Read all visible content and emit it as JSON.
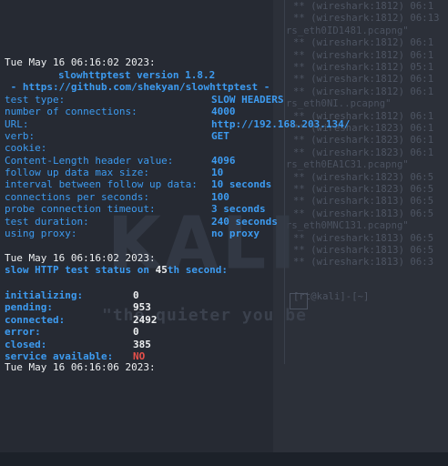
{
  "header": {
    "timestamp_1": "Tue May 16 06:16:02 2023:",
    "version": "slowhttptest version 1.8.2",
    "url_banner": " - https://github.com/shekyan/slowhttptest -"
  },
  "config": [
    {
      "label": "test type:",
      "value": "SLOW HEADERS"
    },
    {
      "label": "number of connections:",
      "value": "4000"
    },
    {
      "label": "URL:",
      "value": "http://192.168.203.134/"
    },
    {
      "label": "verb:",
      "value": "GET"
    },
    {
      "label": "cookie:",
      "value": ""
    },
    {
      "label": "Content-Length header value:",
      "value": "4096"
    },
    {
      "label": "follow up data max size:",
      "value": "10"
    },
    {
      "label": "interval between follow up data:",
      "value": "10 seconds"
    },
    {
      "label": "connections per seconds:",
      "value": "100"
    },
    {
      "label": "probe connection timeout:",
      "value": "3 seconds"
    },
    {
      "label": "test duration:",
      "value": "240 seconds"
    },
    {
      "label": "using proxy:",
      "value": "no proxy"
    }
  ],
  "status": {
    "timestamp_2": "Tue May 16 06:16:02 2023:",
    "status_prefix": "slow HTTP test status on ",
    "status_second": "45",
    "status_suffix": "th second:",
    "rows": [
      {
        "label": "initializing:",
        "value": "0"
      },
      {
        "label": "pending:",
        "value": "953"
      },
      {
        "label": "connected:",
        "value": "2492"
      },
      {
        "label": "error:",
        "value": "0"
      },
      {
        "label": "closed:",
        "value": "385"
      },
      {
        "label": "service available:",
        "value": "NO"
      }
    ],
    "timestamp_3": "Tue May 16 06:16:06 2023:"
  },
  "background": {
    "watermark": "KALI",
    "tagline": "\"the quieter you be",
    "lines": [
      {
        "text": "** (wireshark:1812) 06:1",
        "hdr": false
      },
      {
        "text": "** (wireshark:1812) 06:13",
        "hdr": false
      },
      {
        "text": "rs_eth0ID1481.pcapng\"",
        "hdr": true
      },
      {
        "text": "** (wireshark:1812) 06:1",
        "hdr": false
      },
      {
        "text": "** (wireshark:1812) 06:1",
        "hdr": false
      },
      {
        "text": "** (wireshark:1812) 05:1",
        "hdr": false
      },
      {
        "text": "** (wireshark:1812) 06:1",
        "hdr": false
      },
      {
        "text": "** (wireshark:1812) 06:1",
        "hdr": false
      },
      {
        "text": "rs_eth0NI..pcapng\"",
        "hdr": true
      },
      {
        "text": "** (wireshark:1812) 06:1",
        "hdr": false
      },
      {
        "text": "** (wireshark:1823) 06:1",
        "hdr": false
      },
      {
        "text": "** (wireshark:1823) 06:1",
        "hdr": false
      },
      {
        "text": "** (wireshark:1823) 06:1",
        "hdr": false
      },
      {
        "text": "rs_eth0EA1C31.pcapng\"",
        "hdr": true
      },
      {
        "text": "** (wireshark:1823) 06:5",
        "hdr": false
      },
      {
        "text": "** (wireshark:1823) 06:5",
        "hdr": false
      },
      {
        "text": "** (wireshark:1813) 06:5",
        "hdr": false
      },
      {
        "text": "** (wireshark:1813) 06:5",
        "hdr": false
      },
      {
        "text": "rs_eth0MNC131.pcapng\"",
        "hdr": true
      },
      {
        "text": "** (wireshark:1813) 06:5",
        "hdr": false
      },
      {
        "text": "** (wireshark:1813) 06:5",
        "hdr": false
      },
      {
        "text": "** (wireshark:1813) 06:3",
        "hdr": false
      }
    ],
    "prompt": "[rt@kali]-[~]"
  }
}
